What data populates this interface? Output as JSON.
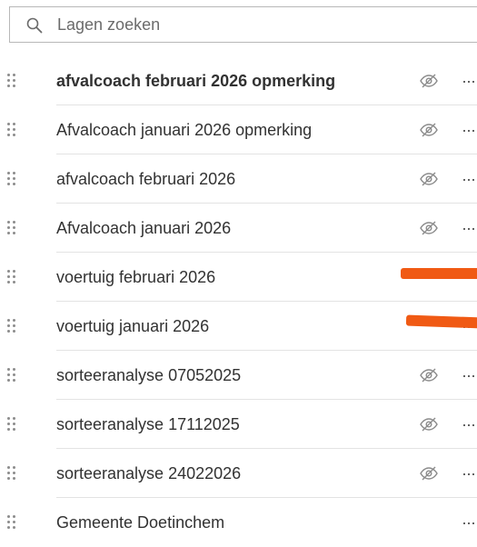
{
  "search": {
    "placeholder": "Lagen zoeken",
    "icon": "search-icon"
  },
  "layers": [
    {
      "label": "afvalcoach februari 2026 opmerking",
      "bold": true,
      "visibility_icon": "eye-off-icon",
      "visible": false
    },
    {
      "label": "Afvalcoach januari 2026 opmerking",
      "bold": false,
      "visibility_icon": "eye-off-icon",
      "visible": false
    },
    {
      "label": "afvalcoach februari 2026",
      "bold": false,
      "visibility_icon": "eye-off-icon",
      "visible": false
    },
    {
      "label": "Afvalcoach januari 2026",
      "bold": false,
      "visibility_icon": "eye-off-icon",
      "visible": false
    },
    {
      "label": "voertuig februari 2026",
      "bold": false,
      "visibility_icon": "redacted",
      "visible": null
    },
    {
      "label": "voertuig januari 2026",
      "bold": false,
      "visibility_icon": "redacted",
      "visible": null
    },
    {
      "label": "sorteeranalyse 07052025",
      "bold": false,
      "visibility_icon": "eye-off-icon",
      "visible": false
    },
    {
      "label": "sorteeranalyse 17112025",
      "bold": false,
      "visibility_icon": "eye-off-icon",
      "visible": false
    },
    {
      "label": "sorteeranalyse 24022026",
      "bold": false,
      "visibility_icon": "eye-off-icon",
      "visible": false
    },
    {
      "label": "Gemeente Doetinchem",
      "bold": false,
      "visibility_icon": "none",
      "visible": null
    }
  ],
  "more_label": "···",
  "colors": {
    "text": "#323232",
    "icon": "#8c8c8c",
    "divider": "#e3e3e3",
    "redaction": "#f05a14"
  }
}
